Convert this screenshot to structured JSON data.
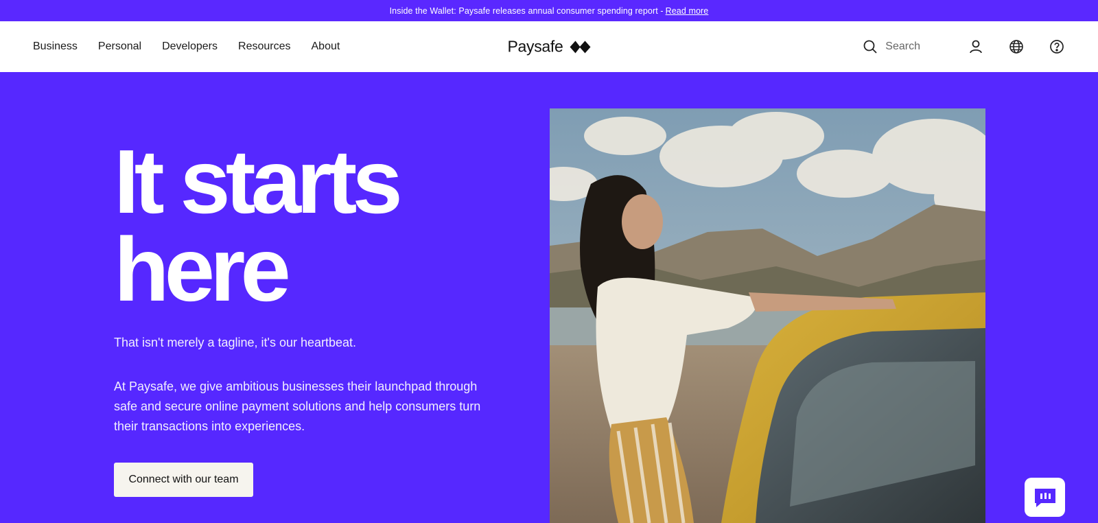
{
  "announcement": {
    "text": "Inside the Wallet: Paysafe releases annual consumer spending report - ",
    "link": "Read more"
  },
  "nav": {
    "items": [
      {
        "label": "Business"
      },
      {
        "label": "Personal"
      },
      {
        "label": "Developers"
      },
      {
        "label": "Resources"
      },
      {
        "label": "About"
      }
    ],
    "logo": "Paysafe",
    "search_label": "Search",
    "icons": [
      "search-icon",
      "user-icon",
      "globe-icon",
      "help-icon"
    ]
  },
  "hero": {
    "headline_line1": "It starts",
    "headline_line2": "here",
    "tagline": "That isn't merely a tagline, it's our heartbeat.",
    "description": "At Paysafe, we give ambitious businesses their launchpad through safe and secure online payment solutions and help consumers turn their transactions into experiences.",
    "cta": "Connect with our team"
  },
  "colors": {
    "brand_purple": "#5628ff",
    "cta_bg": "#f6f4ee",
    "text_dark": "#111111"
  }
}
